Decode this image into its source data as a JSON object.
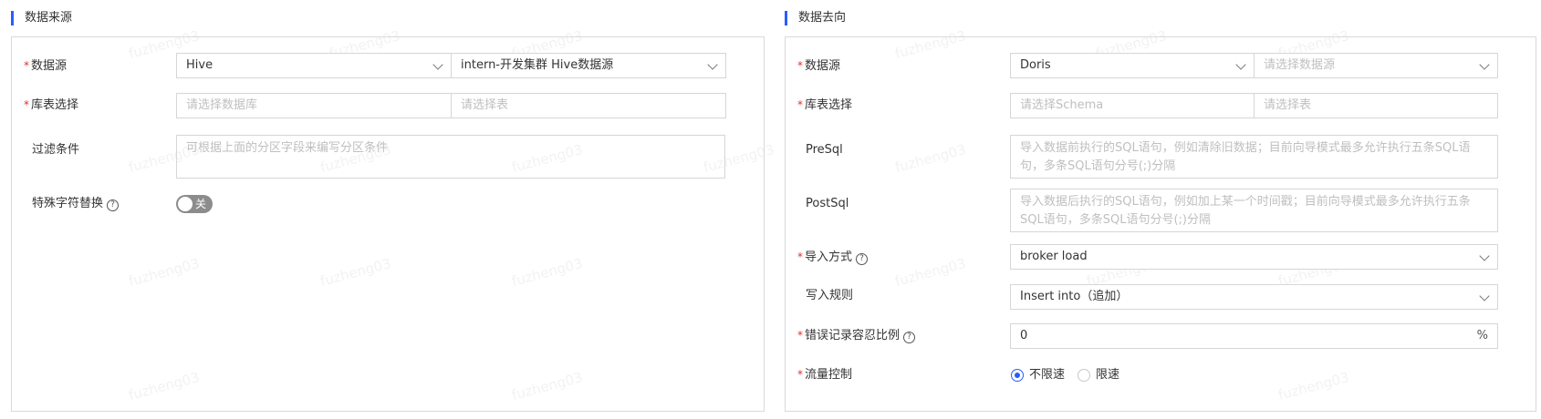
{
  "source": {
    "title": "数据来源",
    "datasource_label": "数据源",
    "datasource_type": "Hive",
    "datasource_cluster": "intern-开发集群 Hive数据源",
    "table_label": "库表选择",
    "db_placeholder": "请选择数据库",
    "table_placeholder": "请选择表",
    "filter_label": "过滤条件",
    "filter_placeholder": "可根据上面的分区字段来编写分区条件",
    "special_label": "特殊字符替换",
    "toggle_text": "关",
    "toggle_on": false
  },
  "target": {
    "title": "数据去向",
    "datasource_label": "数据源",
    "datasource_type": "Doris",
    "datasource_placeholder": "请选择数据源",
    "table_label": "库表选择",
    "schema_placeholder": "请选择Schema",
    "table_placeholder": "请选择表",
    "presql_label": "PreSql",
    "presql_placeholder": "导入数据前执行的SQL语句，例如清除旧数据；目前向导模式最多允许执行五条SQL语句，多条SQL语句分号(;)分隔",
    "postsql_label": "PostSql",
    "postsql_placeholder": "导入数据后执行的SQL语句，例如加上某一个时间戳；目前向导模式最多允许执行五条SQL语句，多条SQL语句分号(;)分隔",
    "import_label": "导入方式",
    "import_value": "broker load",
    "write_label": "写入规则",
    "write_value": "Insert into（追加）",
    "error_label": "错误记录容忍比例",
    "error_value": "0",
    "error_suffix": "%",
    "flow_label": "流量控制",
    "flow_option_1": "不限速",
    "flow_option_2": "限速",
    "flow_selected": "不限速"
  },
  "watermark": "fuzheng03",
  "colors": {
    "accent": "#2a5cff",
    "required": "#e0302b",
    "border": "#d6d6d6"
  }
}
